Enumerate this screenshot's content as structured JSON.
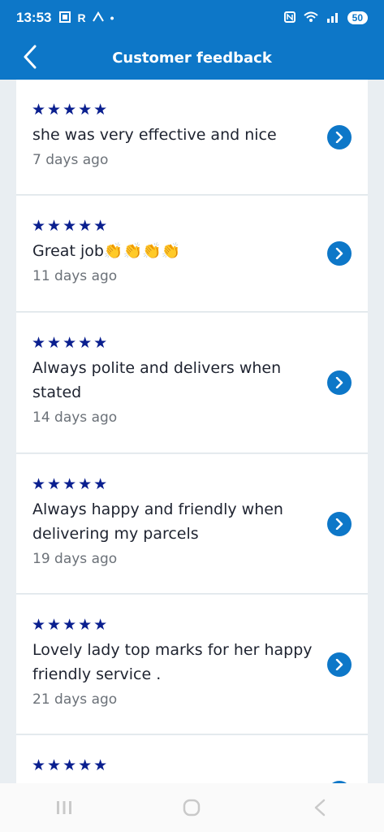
{
  "status_bar": {
    "time": "13:53",
    "icons": [
      "screenshot-icon",
      "r-icon",
      "cast-icon",
      "dot-icon"
    ],
    "right_icons": [
      "nfc-icon",
      "wifi-icon",
      "signal-icon"
    ],
    "battery": "50"
  },
  "header": {
    "title": "Customer feedback",
    "back_icon": "chevron-left-icon"
  },
  "feedback": [
    {
      "stars": "★★★★★",
      "rating": 5,
      "comment": "she was very effective and nice",
      "date": "7 days ago"
    },
    {
      "stars": "★★★★★",
      "rating": 5,
      "comment": "Great job👏👏👏👏",
      "date": "11 days ago"
    },
    {
      "stars": "★★★★★",
      "rating": 5,
      "comment": "Always polite and delivers when stated",
      "date": "14 days ago"
    },
    {
      "stars": "★★★★★",
      "rating": 5,
      "comment": "Always happy and friendly when delivering my parcels",
      "date": "19 days ago"
    },
    {
      "stars": "★★★★★",
      "rating": 5,
      "comment": "Lovely lady top marks for her happy friendly service .",
      "date": "21 days ago"
    },
    {
      "stars": "★★★★★",
      "rating": 5,
      "comment": "",
      "date": ""
    }
  ],
  "nav": [
    "recents-icon",
    "home-icon",
    "back-icon"
  ],
  "colors": {
    "primary": "#0d77c8",
    "star": "#0a1f8f",
    "background": "#e9eef2"
  }
}
